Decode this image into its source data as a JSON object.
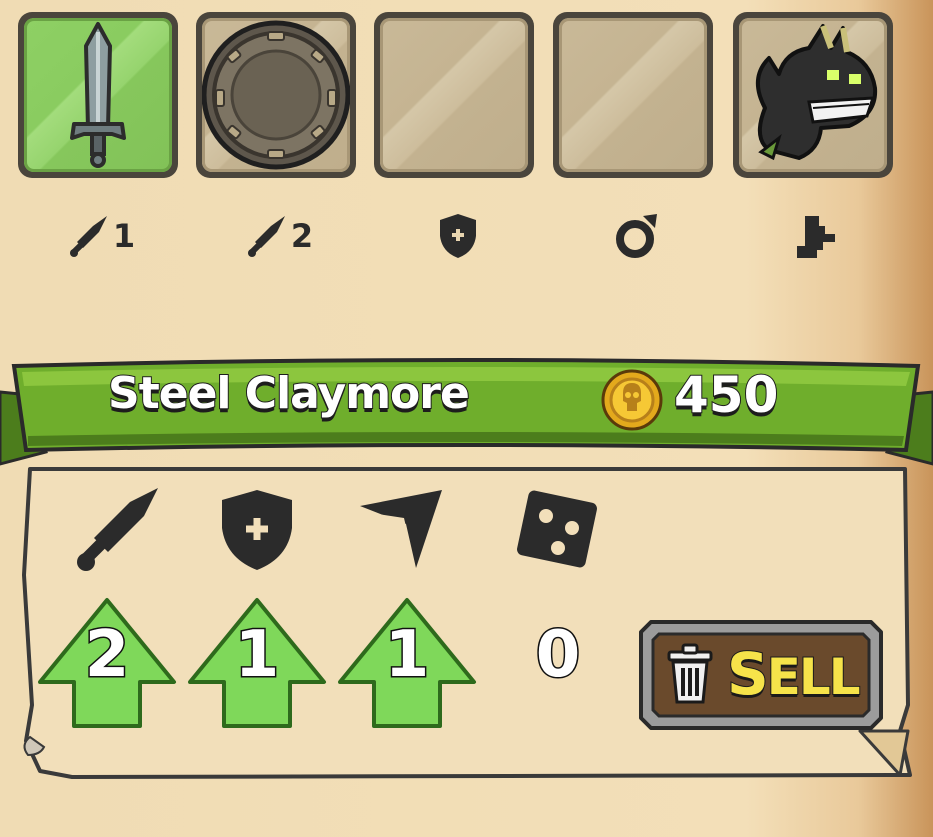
{
  "equipment_slots": [
    {
      "name": "weapon-1",
      "item_icon": "sword-icon",
      "active": true,
      "label_icon": "sword-icon",
      "label_num": "1"
    },
    {
      "name": "weapon-2",
      "item_icon": "round-shield-icon",
      "active": false,
      "label_icon": "sword-icon",
      "label_num": "2"
    },
    {
      "name": "armor",
      "item_icon": "",
      "active": false,
      "label_icon": "shield-plus-icon",
      "label_num": ""
    },
    {
      "name": "ring",
      "item_icon": "",
      "active": false,
      "label_icon": "ring-icon",
      "label_num": ""
    },
    {
      "name": "pet",
      "item_icon": "dragon-pet-icon",
      "active": false,
      "label_icon": "boot-icon",
      "label_num": ""
    }
  ],
  "item": {
    "name": "Steel Claymore",
    "price": "450",
    "currency_icon": "skull-coin-icon"
  },
  "stats": [
    {
      "icon": "sword-icon",
      "value": "2",
      "upgraded": true
    },
    {
      "icon": "shield-plus-icon",
      "value": "1",
      "upgraded": true
    },
    {
      "icon": "crit-angle-icon",
      "value": "1",
      "upgraded": true
    },
    {
      "icon": "dice-icon",
      "value": "0",
      "upgraded": false
    }
  ],
  "sell_button": {
    "label_first": "S",
    "label_rest": "ELL",
    "icon": "trash-icon"
  },
  "colors": {
    "banner_green": "#6fae2c",
    "arrow_green": "#7fd85a",
    "sell_yellow": "#f6e34a",
    "active_slot": "#8ed064"
  }
}
